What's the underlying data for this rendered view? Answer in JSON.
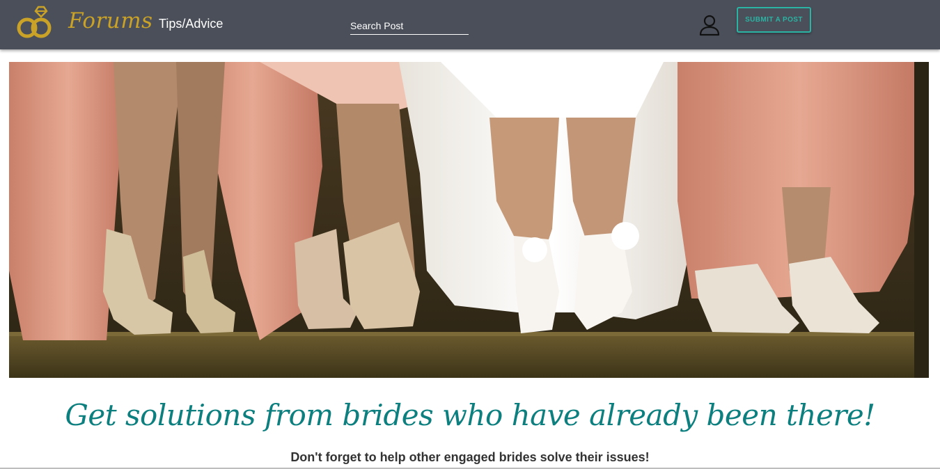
{
  "navbar": {
    "brand": "Forums",
    "nav_link": "Tips/Advice",
    "search_placeholder": "Search Post",
    "submit_label": "SUBMIT A POST"
  },
  "colors": {
    "navbar_bg": "#4a4f5a",
    "brand_gold": "#c9a227",
    "accent_teal": "#2bb3a3",
    "headline_teal": "#0d7f7f"
  },
  "icons": {
    "logo": "wedding-rings-icon",
    "user": "user-profile-icon"
  },
  "hero": {
    "headline": "Get solutions from brides who have already been there!",
    "subheadline": "Don't forget to help other engaged brides solve their issues!"
  }
}
